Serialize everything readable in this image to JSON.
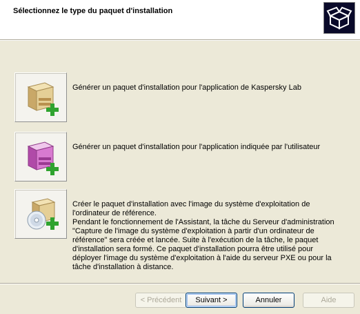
{
  "header": {
    "title": "Sélectionnez le type du paquet d'installation",
    "icon": "open-box-icon"
  },
  "options": [
    {
      "icon": "package-add-icon",
      "lines": [
        "Générer un paquet d'installation pour l'application de Kaspersky Lab"
      ]
    },
    {
      "icon": "package-pink-add-icon",
      "lines": [
        "Générer un paquet d'installation pour l'application indiquée par l'utilisateur"
      ]
    },
    {
      "icon": "disc-package-add-icon",
      "lines": [
        "Créer le paquet d'installation avec l'image du système d'exploitation de l'ordinateur de référence.",
        "Pendant le fonctionnement de l'Assistant, la tâche du Serveur d'administration \"Capture de l'image du système d'exploitation à partir d'un ordinateur de référence\" sera créée et lancée. Suite à l'exécution de la tâche, le paquet d'installation sera formé. Ce paquet d'installation pourra être utilisé pour déployer l'image du système d'exploitation à l'aide du serveur PXE ou pour la tâche d'installation à distance."
      ]
    }
  ],
  "buttons": {
    "back": "< Précédent",
    "next": "Suivant >",
    "cancel": "Annuler",
    "help": "Aide"
  },
  "colors": {
    "dialog_bg": "#ece9d8",
    "accent_plus": "#2fa32f",
    "box_beige": "#d9c08a",
    "box_pink": "#c94fc0"
  }
}
